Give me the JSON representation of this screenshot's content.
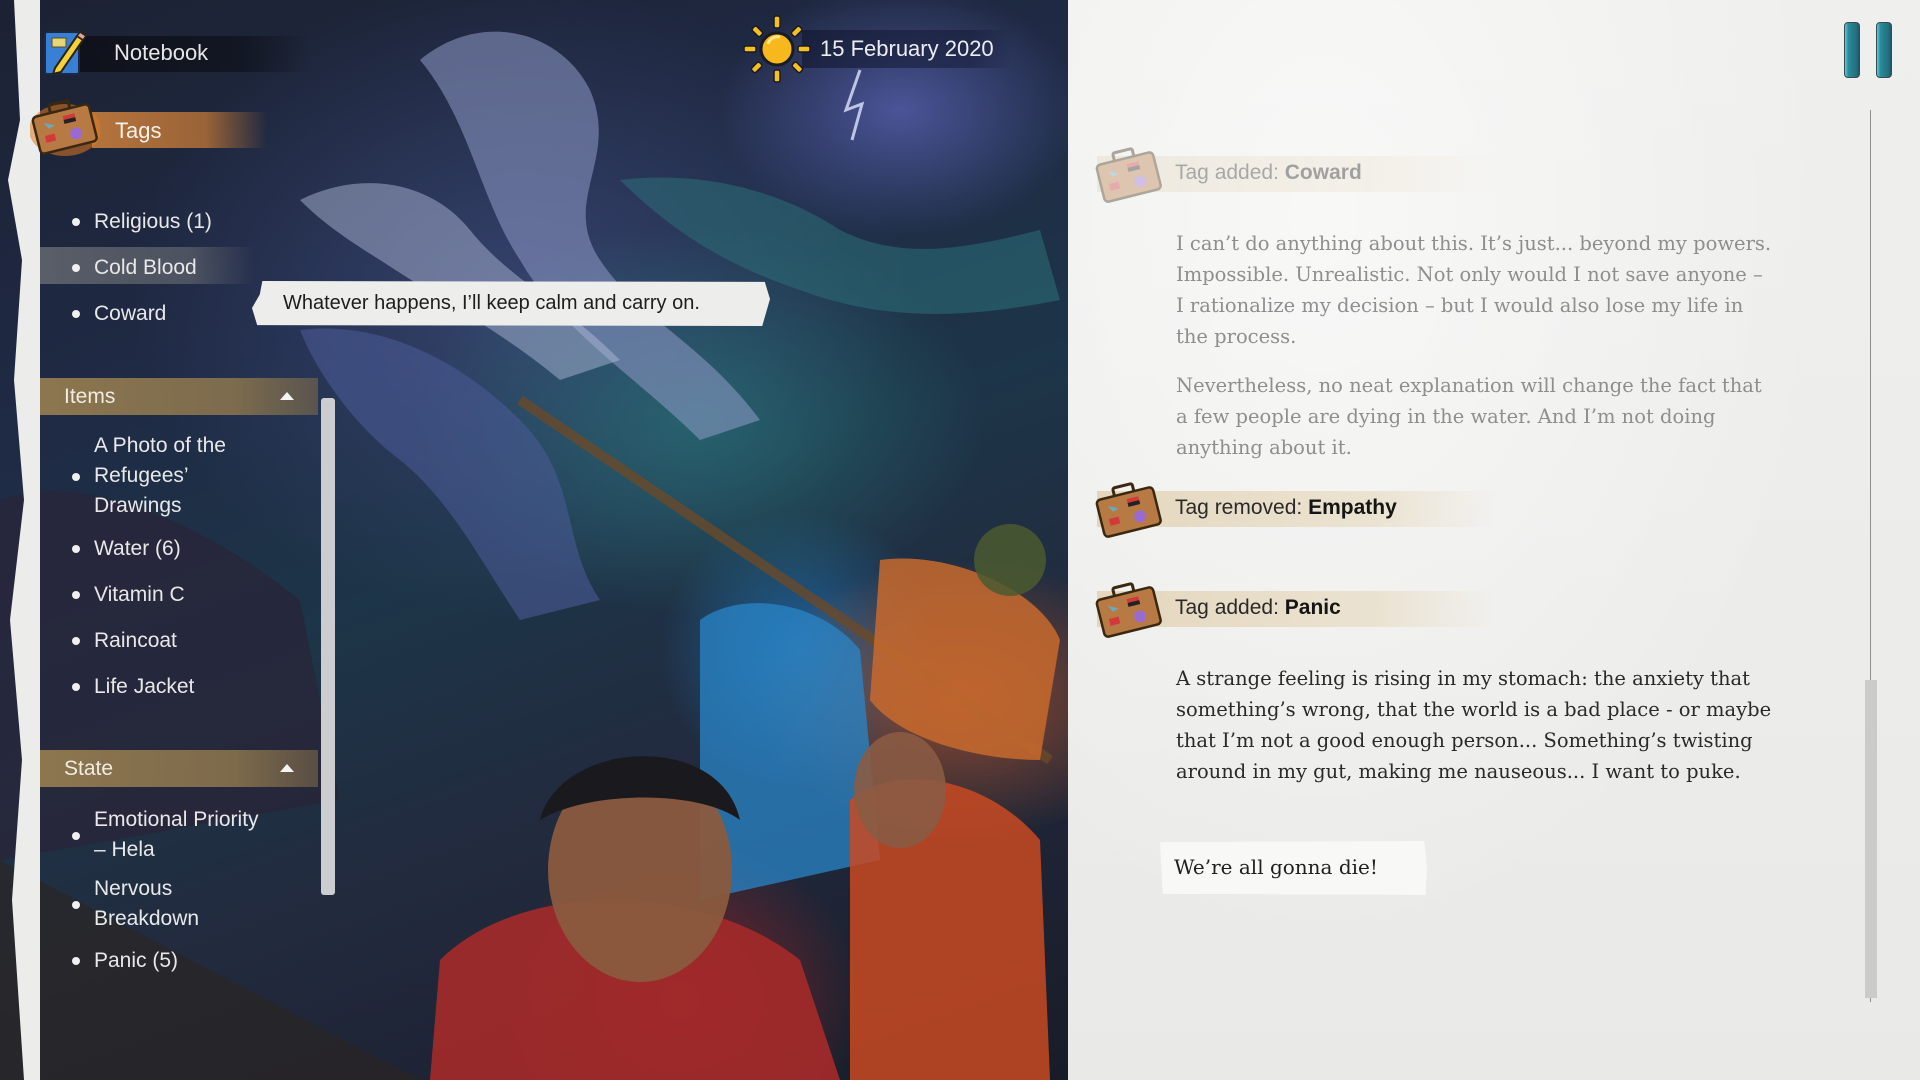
{
  "header": {
    "notebook_label": "Notebook",
    "tags_label": "Tags",
    "date": "15 February 2020",
    "weather_icon": "sun-icon",
    "pause_icon": "pause-icon"
  },
  "tags": {
    "items": [
      {
        "label": "Religious  (1)"
      },
      {
        "label": "Cold Blood",
        "selected": true
      },
      {
        "label": "Coward"
      }
    ],
    "tooltip": "Whatever happens, I’ll keep calm and carry on."
  },
  "items_section": {
    "header": "Items",
    "collapse_icon": "triangle-up-icon",
    "items": [
      {
        "label_lines": [
          "A Photo of the",
          "Refugees’",
          "Drawings"
        ]
      },
      {
        "label": "Water  (6)"
      },
      {
        "label": "Vitamin C"
      },
      {
        "label": "Raincoat"
      },
      {
        "label": "Life Jacket"
      }
    ]
  },
  "state_section": {
    "header": "State",
    "collapse_icon": "triangle-up-icon",
    "items": [
      {
        "label_lines": [
          "Emotional Priority",
          "– Hela"
        ]
      },
      {
        "label_lines": [
          "Nervous",
          "Breakdown"
        ]
      },
      {
        "label": "Panic  (5)"
      }
    ]
  },
  "journal": {
    "entries": [
      {
        "prefix": "Tag added: ",
        "tag": "Coward",
        "faded": true
      },
      {
        "prefix": "Tag removed: ",
        "tag": "Empathy"
      },
      {
        "prefix": "Tag added: ",
        "tag": "Panic"
      }
    ],
    "paragraphs": [
      {
        "text": "I can’t do anything about this. It’s just... beyond my powers. Impossible. Unrealistic. Not only would I not save anyone – I rationalize my decision – but I would also lose my life in the process.",
        "faded": true
      },
      {
        "text": "Nevertheless, no neat explanation will change the fact that a few people are dying in the water. And I’m not doing anything about it.",
        "faded": true
      },
      {
        "text": "A strange feeling is rising in my stomach: the anxiety that something’s wrong, that the world is a bad place - or maybe that I’m not a good enough person... Something’s twisting around in my gut, making me nauseous... I want to puke."
      }
    ],
    "speech": "We’re all gonna die!"
  },
  "colors": {
    "tags_accent": "#be783c",
    "section_header": "#967d50",
    "pause_button": "#2a8a9a",
    "paper": "#ececea"
  }
}
